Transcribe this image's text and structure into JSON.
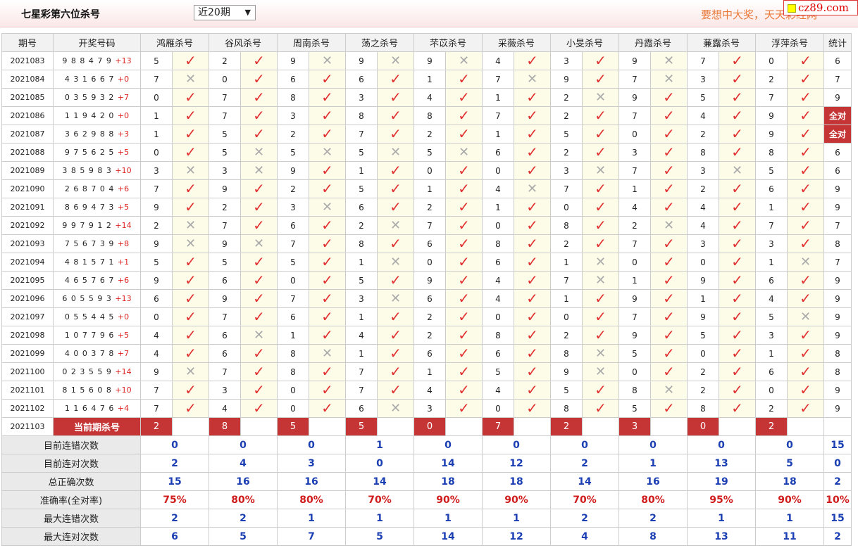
{
  "header": {
    "title": "七星彩第六位杀号",
    "range_select": "近20期",
    "range_arrow": "▼",
    "ad_text": "要想中大奖，天天彩经网",
    "logo_text": "cz89.com"
  },
  "columns": {
    "period": "期号",
    "draw": "开奖号码",
    "experts": [
      "鸿雁杀号",
      "谷风杀号",
      "周南杀号",
      "荡之杀号",
      "芣苡杀号",
      "采薇杀号",
      "小旻杀号",
      "丹霞杀号",
      "蒹露杀号",
      "浮萍杀号"
    ],
    "stat": "统计"
  },
  "rows": [
    {
      "period": "2021083",
      "draw": "9 8 8 4 7 9",
      "sum": "+13",
      "kills": [
        "5",
        "2",
        "9",
        "9",
        "9",
        "4",
        "3",
        "9",
        "7",
        "0"
      ],
      "hits": [
        1,
        1,
        0,
        0,
        0,
        1,
        1,
        0,
        1,
        1
      ],
      "stat": "6"
    },
    {
      "period": "2021084",
      "draw": "4 3 1 6 6 7",
      "sum": "+0",
      "kills": [
        "7",
        "0",
        "6",
        "6",
        "1",
        "7",
        "9",
        "7",
        "3",
        "2"
      ],
      "hits": [
        0,
        1,
        1,
        1,
        1,
        0,
        1,
        0,
        1,
        1
      ],
      "stat": "7"
    },
    {
      "period": "2021085",
      "draw": "0 3 5 9 3 2",
      "sum": "+7",
      "kills": [
        "0",
        "7",
        "8",
        "3",
        "4",
        "1",
        "2",
        "9",
        "5",
        "7"
      ],
      "hits": [
        1,
        1,
        1,
        1,
        1,
        1,
        0,
        1,
        1,
        1
      ],
      "stat": "9"
    },
    {
      "period": "2021086",
      "draw": "1 1 9 4 2 0",
      "sum": "+0",
      "kills": [
        "1",
        "7",
        "3",
        "8",
        "8",
        "7",
        "2",
        "7",
        "4",
        "9"
      ],
      "hits": [
        1,
        1,
        1,
        1,
        1,
        1,
        1,
        1,
        1,
        1
      ],
      "stat": "全对"
    },
    {
      "period": "2021087",
      "draw": "3 6 2 9 8 8",
      "sum": "+3",
      "kills": [
        "1",
        "5",
        "2",
        "7",
        "2",
        "1",
        "5",
        "0",
        "2",
        "9"
      ],
      "hits": [
        1,
        1,
        1,
        1,
        1,
        1,
        1,
        1,
        1,
        1
      ],
      "stat": "全对"
    },
    {
      "period": "2021088",
      "draw": "9 7 5 6 2 5",
      "sum": "+5",
      "kills": [
        "0",
        "5",
        "5",
        "5",
        "5",
        "6",
        "2",
        "3",
        "8",
        "8"
      ],
      "hits": [
        1,
        0,
        0,
        0,
        0,
        1,
        1,
        1,
        1,
        1
      ],
      "stat": "6"
    },
    {
      "period": "2021089",
      "draw": "3 8 5 9 8 3",
      "sum": "+10",
      "kills": [
        "3",
        "3",
        "9",
        "1",
        "0",
        "0",
        "3",
        "7",
        "3",
        "5"
      ],
      "hits": [
        0,
        0,
        1,
        1,
        1,
        1,
        0,
        1,
        0,
        1
      ],
      "stat": "6"
    },
    {
      "period": "2021090",
      "draw": "2 6 8 7 0 4",
      "sum": "+6",
      "kills": [
        "7",
        "9",
        "2",
        "5",
        "1",
        "4",
        "7",
        "1",
        "2",
        "6"
      ],
      "hits": [
        1,
        1,
        1,
        1,
        1,
        0,
        1,
        1,
        1,
        1
      ],
      "stat": "9"
    },
    {
      "period": "2021091",
      "draw": "8 6 9 4 7 3",
      "sum": "+5",
      "kills": [
        "9",
        "2",
        "3",
        "6",
        "2",
        "1",
        "0",
        "4",
        "4",
        "1"
      ],
      "hits": [
        1,
        1,
        0,
        1,
        1,
        1,
        1,
        1,
        1,
        1
      ],
      "stat": "9"
    },
    {
      "period": "2021092",
      "draw": "9 9 7 9 1 2",
      "sum": "+14",
      "kills": [
        "2",
        "7",
        "6",
        "2",
        "7",
        "0",
        "8",
        "2",
        "4",
        "7"
      ],
      "hits": [
        0,
        1,
        1,
        0,
        1,
        1,
        1,
        0,
        1,
        1
      ],
      "stat": "7"
    },
    {
      "period": "2021093",
      "draw": "7 5 6 7 3 9",
      "sum": "+8",
      "kills": [
        "9",
        "9",
        "7",
        "8",
        "6",
        "8",
        "2",
        "7",
        "3",
        "3"
      ],
      "hits": [
        0,
        0,
        1,
        1,
        1,
        1,
        1,
        1,
        1,
        1
      ],
      "stat": "8"
    },
    {
      "period": "2021094",
      "draw": "4 8 1 5 7 1",
      "sum": "+1",
      "kills": [
        "5",
        "5",
        "5",
        "1",
        "0",
        "6",
        "1",
        "0",
        "0",
        "1"
      ],
      "hits": [
        1,
        1,
        1,
        0,
        1,
        1,
        0,
        1,
        1,
        0
      ],
      "stat": "7"
    },
    {
      "period": "2021095",
      "draw": "4 6 5 7 6 7",
      "sum": "+6",
      "kills": [
        "9",
        "6",
        "0",
        "5",
        "9",
        "4",
        "7",
        "1",
        "9",
        "6"
      ],
      "hits": [
        1,
        1,
        1,
        1,
        1,
        1,
        0,
        1,
        1,
        1
      ],
      "stat": "9"
    },
    {
      "period": "2021096",
      "draw": "6 0 5 5 9 3",
      "sum": "+13",
      "kills": [
        "6",
        "9",
        "7",
        "3",
        "6",
        "4",
        "1",
        "9",
        "1",
        "4"
      ],
      "hits": [
        1,
        1,
        1,
        0,
        1,
        1,
        1,
        1,
        1,
        1
      ],
      "stat": "9"
    },
    {
      "period": "2021097",
      "draw": "0 5 5 4 4 5",
      "sum": "+0",
      "kills": [
        "0",
        "7",
        "6",
        "1",
        "2",
        "0",
        "0",
        "7",
        "9",
        "5"
      ],
      "hits": [
        1,
        1,
        1,
        1,
        1,
        1,
        1,
        1,
        1,
        0
      ],
      "stat": "9"
    },
    {
      "period": "2021098",
      "draw": "1 0 7 7 9 6",
      "sum": "+5",
      "kills": [
        "4",
        "6",
        "1",
        "4",
        "2",
        "8",
        "2",
        "9",
        "5",
        "3"
      ],
      "hits": [
        1,
        0,
        1,
        1,
        1,
        1,
        1,
        1,
        1,
        1
      ],
      "stat": "9"
    },
    {
      "period": "2021099",
      "draw": "4 0 0 3 7 8",
      "sum": "+7",
      "kills": [
        "4",
        "6",
        "8",
        "1",
        "6",
        "6",
        "8",
        "5",
        "0",
        "1"
      ],
      "hits": [
        1,
        1,
        0,
        1,
        1,
        1,
        0,
        1,
        1,
        1
      ],
      "stat": "8"
    },
    {
      "period": "2021100",
      "draw": "0 2 3 5 5 9",
      "sum": "+14",
      "kills": [
        "9",
        "7",
        "8",
        "7",
        "1",
        "5",
        "9",
        "0",
        "2",
        "6"
      ],
      "hits": [
        0,
        1,
        1,
        1,
        1,
        1,
        0,
        1,
        1,
        1
      ],
      "stat": "8"
    },
    {
      "period": "2021101",
      "draw": "8 1 5 6 0 8",
      "sum": "+10",
      "kills": [
        "7",
        "3",
        "0",
        "7",
        "4",
        "4",
        "5",
        "8",
        "2",
        "0"
      ],
      "hits": [
        1,
        1,
        1,
        1,
        1,
        1,
        1,
        0,
        1,
        1
      ],
      "stat": "9"
    },
    {
      "period": "2021102",
      "draw": "1 1 6 4 7 6",
      "sum": "+4",
      "kills": [
        "7",
        "4",
        "0",
        "6",
        "3",
        "0",
        "8",
        "5",
        "8",
        "2"
      ],
      "hits": [
        1,
        1,
        1,
        0,
        1,
        1,
        1,
        1,
        1,
        1
      ],
      "stat": "9"
    }
  ],
  "current": {
    "period": "2021103",
    "label": "当前期杀号",
    "kills": [
      "2",
      "8",
      "5",
      "5",
      "0",
      "7",
      "2",
      "3",
      "0",
      "2"
    ]
  },
  "summary": [
    {
      "label": "目前连错次数",
      "values": [
        "0",
        "0",
        "0",
        "1",
        "0",
        "0",
        "0",
        "0",
        "0",
        "0"
      ],
      "stat": "15"
    },
    {
      "label": "目前连对次数",
      "values": [
        "2",
        "4",
        "3",
        "0",
        "14",
        "12",
        "2",
        "1",
        "13",
        "5"
      ],
      "stat": "0"
    },
    {
      "label": "总正确次数",
      "values": [
        "15",
        "16",
        "16",
        "14",
        "18",
        "18",
        "14",
        "16",
        "19",
        "18"
      ],
      "stat": "2"
    },
    {
      "label": "准确率(全对率)",
      "values": [
        "75%",
        "80%",
        "80%",
        "70%",
        "90%",
        "90%",
        "70%",
        "80%",
        "95%",
        "90%"
      ],
      "stat": "10%",
      "rate": true
    },
    {
      "label": "最大连错次数",
      "values": [
        "2",
        "2",
        "1",
        "1",
        "1",
        "1",
        "2",
        "2",
        "1",
        "1"
      ],
      "stat": "15"
    },
    {
      "label": "最大连对次数",
      "values": [
        "6",
        "5",
        "7",
        "5",
        "14",
        "12",
        "4",
        "8",
        "13",
        "11"
      ],
      "stat": "2"
    }
  ],
  "symbols": {
    "ok": "✓",
    "no": "✕"
  },
  "colors": {
    "accent": "#c53535",
    "summary_blue": "#1b3fb3",
    "rate_red": "#d01c1c",
    "check_red": "#e03030"
  }
}
